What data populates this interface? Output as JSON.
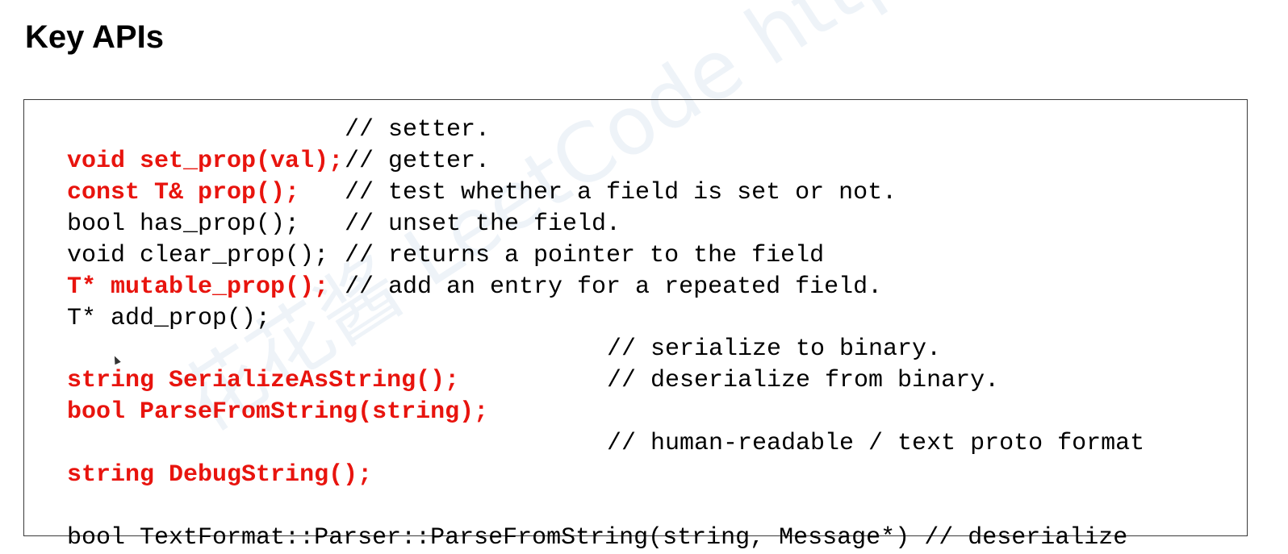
{
  "title": "Key APIs",
  "watermark": "花花酱 LeetCode https://zxi.mytechroad.com/blog/",
  "lines": [
    {
      "sig": "void set_prop(val);",
      "comment": "// setter."
    },
    {
      "sig": "const T& prop();",
      "comment": "// getter."
    },
    {
      "sig": "bool has_prop();",
      "comment": "// test whether a field is set or not."
    },
    {
      "sig": "void clear_prop();",
      "comment": "// unset the field."
    },
    {
      "sig": "T* mutable_prop();",
      "comment": "// returns a pointer to the field"
    },
    {
      "sig": "T* add_prop();",
      "comment": "// add an entry for a repeated field."
    },
    {
      "sig": "string SerializeAsString();",
      "comment": "// serialize to binary."
    },
    {
      "sig": "bool ParseFromString(string);",
      "comment": "// deserialize from binary."
    },
    {
      "sig": "string DebugString();",
      "comment": "// human-readable / text proto format"
    },
    {
      "sig": "bool TextFormat::Parser::ParseFromString(string, Message*) // deserialize"
    }
  ],
  "colors": {
    "highlight": "#e8140e",
    "text": "#000000",
    "border": "#3a3a3a"
  }
}
